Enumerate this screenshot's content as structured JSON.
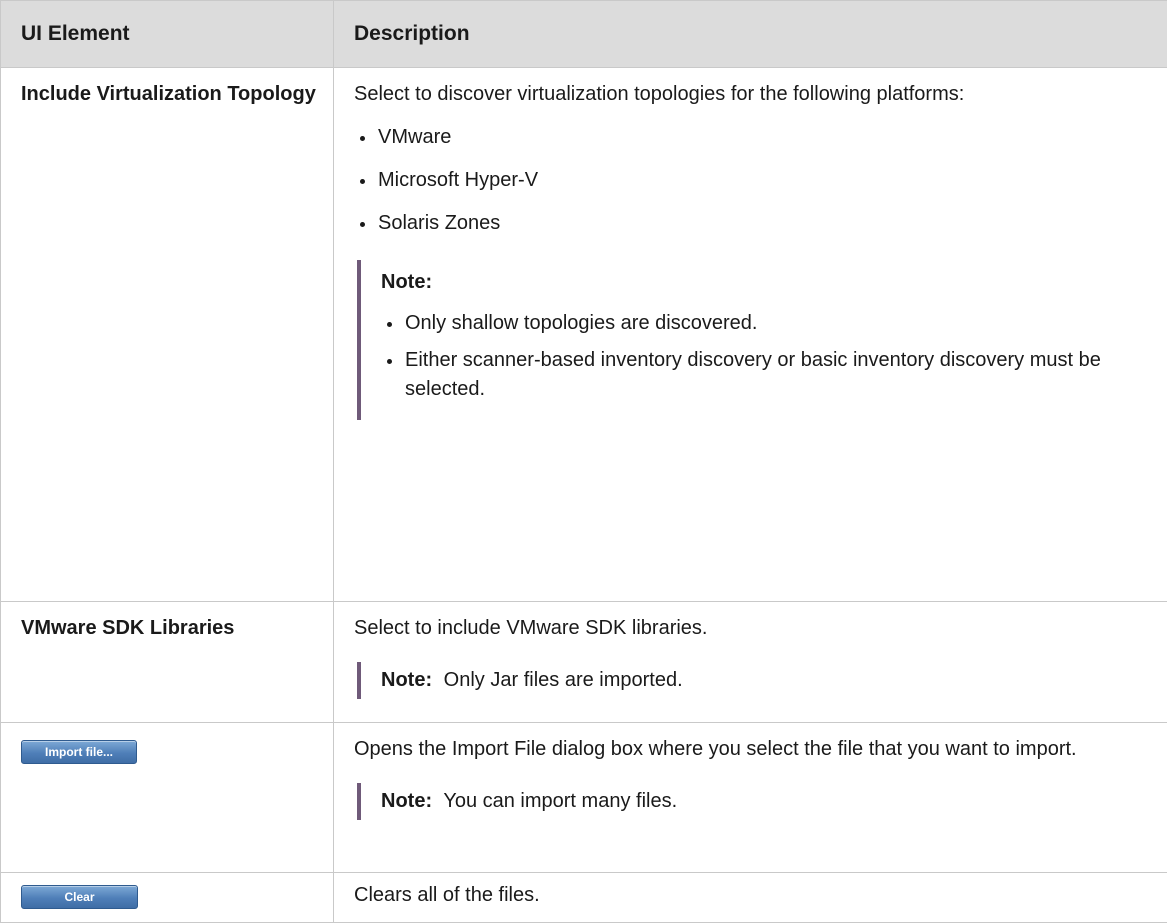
{
  "table": {
    "headers": {
      "element": "UI Element",
      "description": "Description"
    },
    "rows": {
      "virtualization": {
        "element": "Include Virtualization Topology",
        "description": "Select to discover virtualization topologies for the following platforms:",
        "platforms": [
          "VMware",
          "Microsoft Hyper-V",
          "Solaris Zones"
        ],
        "note_title": "Note:",
        "notes": [
          "Only shallow topologies are discovered.",
          "Either scanner-based inventory discovery or basic inventory discovery must be selected."
        ]
      },
      "sdk": {
        "element": "VMware SDK Libraries",
        "description": "Select to include VMware SDK libraries.",
        "note_label": "Note:",
        "note_text": "Only Jar files are imported."
      },
      "import": {
        "button_label": "Import file...",
        "description": "Opens the Import File dialog box where you select the file that you want to import.",
        "note_label": "Note:",
        "note_text": "You can import many files."
      },
      "clear": {
        "button_label": "Clear",
        "description": "Clears all of the files."
      }
    }
  },
  "colors": {
    "header_bg": "#dcdcdc",
    "note_bar": "#6f5a79",
    "button_blue": "#4f7fb8",
    "grid": "#c9c9c9"
  }
}
